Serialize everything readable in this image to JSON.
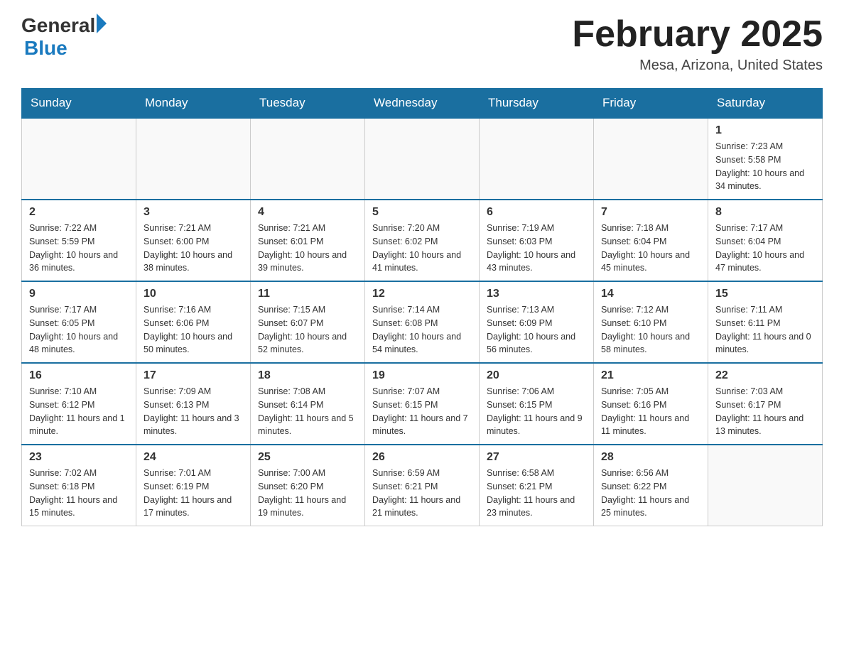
{
  "header": {
    "logo_general": "General",
    "logo_blue": "Blue",
    "month_title": "February 2025",
    "location": "Mesa, Arizona, United States"
  },
  "days_of_week": [
    "Sunday",
    "Monday",
    "Tuesday",
    "Wednesday",
    "Thursday",
    "Friday",
    "Saturday"
  ],
  "weeks": [
    {
      "days": [
        {
          "number": "",
          "info": ""
        },
        {
          "number": "",
          "info": ""
        },
        {
          "number": "",
          "info": ""
        },
        {
          "number": "",
          "info": ""
        },
        {
          "number": "",
          "info": ""
        },
        {
          "number": "",
          "info": ""
        },
        {
          "number": "1",
          "info": "Sunrise: 7:23 AM\nSunset: 5:58 PM\nDaylight: 10 hours and 34 minutes."
        }
      ]
    },
    {
      "days": [
        {
          "number": "2",
          "info": "Sunrise: 7:22 AM\nSunset: 5:59 PM\nDaylight: 10 hours and 36 minutes."
        },
        {
          "number": "3",
          "info": "Sunrise: 7:21 AM\nSunset: 6:00 PM\nDaylight: 10 hours and 38 minutes."
        },
        {
          "number": "4",
          "info": "Sunrise: 7:21 AM\nSunset: 6:01 PM\nDaylight: 10 hours and 39 minutes."
        },
        {
          "number": "5",
          "info": "Sunrise: 7:20 AM\nSunset: 6:02 PM\nDaylight: 10 hours and 41 minutes."
        },
        {
          "number": "6",
          "info": "Sunrise: 7:19 AM\nSunset: 6:03 PM\nDaylight: 10 hours and 43 minutes."
        },
        {
          "number": "7",
          "info": "Sunrise: 7:18 AM\nSunset: 6:04 PM\nDaylight: 10 hours and 45 minutes."
        },
        {
          "number": "8",
          "info": "Sunrise: 7:17 AM\nSunset: 6:04 PM\nDaylight: 10 hours and 47 minutes."
        }
      ]
    },
    {
      "days": [
        {
          "number": "9",
          "info": "Sunrise: 7:17 AM\nSunset: 6:05 PM\nDaylight: 10 hours and 48 minutes."
        },
        {
          "number": "10",
          "info": "Sunrise: 7:16 AM\nSunset: 6:06 PM\nDaylight: 10 hours and 50 minutes."
        },
        {
          "number": "11",
          "info": "Sunrise: 7:15 AM\nSunset: 6:07 PM\nDaylight: 10 hours and 52 minutes."
        },
        {
          "number": "12",
          "info": "Sunrise: 7:14 AM\nSunset: 6:08 PM\nDaylight: 10 hours and 54 minutes."
        },
        {
          "number": "13",
          "info": "Sunrise: 7:13 AM\nSunset: 6:09 PM\nDaylight: 10 hours and 56 minutes."
        },
        {
          "number": "14",
          "info": "Sunrise: 7:12 AM\nSunset: 6:10 PM\nDaylight: 10 hours and 58 minutes."
        },
        {
          "number": "15",
          "info": "Sunrise: 7:11 AM\nSunset: 6:11 PM\nDaylight: 11 hours and 0 minutes."
        }
      ]
    },
    {
      "days": [
        {
          "number": "16",
          "info": "Sunrise: 7:10 AM\nSunset: 6:12 PM\nDaylight: 11 hours and 1 minute."
        },
        {
          "number": "17",
          "info": "Sunrise: 7:09 AM\nSunset: 6:13 PM\nDaylight: 11 hours and 3 minutes."
        },
        {
          "number": "18",
          "info": "Sunrise: 7:08 AM\nSunset: 6:14 PM\nDaylight: 11 hours and 5 minutes."
        },
        {
          "number": "19",
          "info": "Sunrise: 7:07 AM\nSunset: 6:15 PM\nDaylight: 11 hours and 7 minutes."
        },
        {
          "number": "20",
          "info": "Sunrise: 7:06 AM\nSunset: 6:15 PM\nDaylight: 11 hours and 9 minutes."
        },
        {
          "number": "21",
          "info": "Sunrise: 7:05 AM\nSunset: 6:16 PM\nDaylight: 11 hours and 11 minutes."
        },
        {
          "number": "22",
          "info": "Sunrise: 7:03 AM\nSunset: 6:17 PM\nDaylight: 11 hours and 13 minutes."
        }
      ]
    },
    {
      "days": [
        {
          "number": "23",
          "info": "Sunrise: 7:02 AM\nSunset: 6:18 PM\nDaylight: 11 hours and 15 minutes."
        },
        {
          "number": "24",
          "info": "Sunrise: 7:01 AM\nSunset: 6:19 PM\nDaylight: 11 hours and 17 minutes."
        },
        {
          "number": "25",
          "info": "Sunrise: 7:00 AM\nSunset: 6:20 PM\nDaylight: 11 hours and 19 minutes."
        },
        {
          "number": "26",
          "info": "Sunrise: 6:59 AM\nSunset: 6:21 PM\nDaylight: 11 hours and 21 minutes."
        },
        {
          "number": "27",
          "info": "Sunrise: 6:58 AM\nSunset: 6:21 PM\nDaylight: 11 hours and 23 minutes."
        },
        {
          "number": "28",
          "info": "Sunrise: 6:56 AM\nSunset: 6:22 PM\nDaylight: 11 hours and 25 minutes."
        },
        {
          "number": "",
          "info": ""
        }
      ]
    }
  ]
}
